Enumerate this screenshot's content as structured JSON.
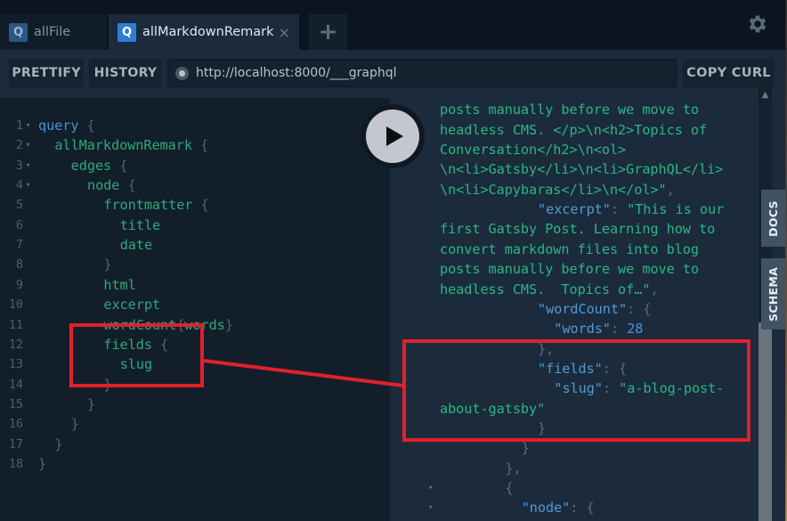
{
  "tabs": [
    {
      "badge": "Q",
      "label": "allFile",
      "active": false
    },
    {
      "badge": "Q",
      "label": "allMarkdownRemark",
      "active": true,
      "close": "×"
    }
  ],
  "new_tab_label": "+",
  "toolbar": {
    "prettify_label": "PRETTIFY",
    "history_label": "HISTORY",
    "url": "http://localhost:8000/___graphql",
    "copy_curl_label": "COPY CURL"
  },
  "side_tabs": {
    "docs": "DOCS",
    "schema": "SCHEMA"
  },
  "icons": {
    "settings": "gear-icon",
    "run": "play-icon",
    "scroll_up": "chevron-up-icon"
  },
  "colors": {
    "annotation": "#e0212b",
    "keyword": "#4a8fd6",
    "field": "#2fa87a",
    "string": "#2bb585",
    "key": "#4f9ad6"
  },
  "editor": {
    "lines": [
      {
        "n": "1",
        "fold": true,
        "indent": 0,
        "parts": [
          {
            "t": "query",
            "c": "kw"
          },
          {
            "t": " {",
            "c": "pn"
          }
        ]
      },
      {
        "n": "2",
        "fold": true,
        "indent": 2,
        "parts": [
          {
            "t": "allMarkdownRemark",
            "c": "fld"
          },
          {
            "t": " {",
            "c": "pn"
          }
        ]
      },
      {
        "n": "3",
        "fold": true,
        "indent": 4,
        "parts": [
          {
            "t": "edges",
            "c": "fld"
          },
          {
            "t": " {",
            "c": "pn"
          }
        ]
      },
      {
        "n": "4",
        "fold": true,
        "indent": 6,
        "parts": [
          {
            "t": "node",
            "c": "fld"
          },
          {
            "t": " {",
            "c": "pn"
          }
        ]
      },
      {
        "n": "5",
        "fold": false,
        "indent": 8,
        "parts": [
          {
            "t": "frontmatter",
            "c": "fld"
          },
          {
            "t": " {",
            "c": "pn"
          }
        ]
      },
      {
        "n": "6",
        "fold": false,
        "indent": 10,
        "parts": [
          {
            "t": "title",
            "c": "fld"
          }
        ]
      },
      {
        "n": "7",
        "fold": false,
        "indent": 10,
        "parts": [
          {
            "t": "date",
            "c": "fld"
          }
        ]
      },
      {
        "n": "8",
        "fold": false,
        "indent": 8,
        "parts": [
          {
            "t": "}",
            "c": "pn"
          }
        ]
      },
      {
        "n": "9",
        "fold": false,
        "indent": 8,
        "parts": [
          {
            "t": "html",
            "c": "fld"
          }
        ]
      },
      {
        "n": "10",
        "fold": false,
        "indent": 8,
        "parts": [
          {
            "t": "excerpt",
            "c": "fld"
          }
        ]
      },
      {
        "n": "11",
        "fold": false,
        "indent": 8,
        "parts": [
          {
            "t": "wordCount",
            "c": "fld"
          },
          {
            "t": "{",
            "c": "pn"
          },
          {
            "t": "words",
            "c": "fld"
          },
          {
            "t": "}",
            "c": "pn"
          }
        ]
      },
      {
        "n": "12",
        "fold": false,
        "indent": 8,
        "parts": [
          {
            "t": "fields",
            "c": "fld"
          },
          {
            "t": " {",
            "c": "pn"
          }
        ]
      },
      {
        "n": "13",
        "fold": false,
        "indent": 10,
        "parts": [
          {
            "t": "slug",
            "c": "fld"
          }
        ]
      },
      {
        "n": "14",
        "fold": false,
        "indent": 8,
        "parts": [
          {
            "t": "}",
            "c": "pn"
          }
        ]
      },
      {
        "n": "15",
        "fold": false,
        "indent": 6,
        "parts": [
          {
            "t": "}",
            "c": "pn"
          }
        ]
      },
      {
        "n": "16",
        "fold": false,
        "indent": 4,
        "parts": [
          {
            "t": "}",
            "c": "pn"
          }
        ]
      },
      {
        "n": "17",
        "fold": false,
        "indent": 2,
        "parts": [
          {
            "t": "}",
            "c": "pn"
          }
        ]
      },
      {
        "n": "18",
        "fold": false,
        "indent": 0,
        "parts": [
          {
            "t": "}",
            "c": "pn"
          }
        ]
      }
    ]
  },
  "result": {
    "lines": [
      {
        "indent": 0,
        "fold": false,
        "parts": [
          {
            "t": "convert markdown files into blog",
            "c": "rs"
          }
        ]
      },
      {
        "indent": 0,
        "fold": false,
        "parts": [
          {
            "t": "posts manually before we move to",
            "c": "rs"
          }
        ]
      },
      {
        "indent": 0,
        "fold": false,
        "parts": [
          {
            "t": "headless CMS. </p>\\n<h2>Topics of",
            "c": "rs"
          }
        ]
      },
      {
        "indent": 0,
        "fold": false,
        "parts": [
          {
            "t": "Conversation</h2>\\n<ol>",
            "c": "rs"
          }
        ]
      },
      {
        "indent": 0,
        "fold": false,
        "parts": [
          {
            "t": "\\n<li>Gatsby</li>\\n<li>GraphQL</li>",
            "c": "rs"
          }
        ]
      },
      {
        "indent": 0,
        "fold": false,
        "parts": [
          {
            "t": "\\n<li>Capybaras</li>\\n</ol>\"",
            "c": "rs"
          },
          {
            "t": ",",
            "c": "rp"
          }
        ]
      },
      {
        "indent": 12,
        "fold": false,
        "parts": [
          {
            "t": "\"excerpt\"",
            "c": "rk"
          },
          {
            "t": ": ",
            "c": "rp"
          },
          {
            "t": "\"This is our",
            "c": "rs"
          }
        ]
      },
      {
        "indent": 0,
        "fold": false,
        "parts": [
          {
            "t": "first Gatsby Post. Learning how to",
            "c": "rs"
          }
        ]
      },
      {
        "indent": 0,
        "fold": false,
        "parts": [
          {
            "t": "convert markdown files into blog",
            "c": "rs"
          }
        ]
      },
      {
        "indent": 0,
        "fold": false,
        "parts": [
          {
            "t": "posts manually before we move to",
            "c": "rs"
          }
        ]
      },
      {
        "indent": 0,
        "fold": false,
        "parts": [
          {
            "t": "headless CMS.  Topics of…\"",
            "c": "rs"
          },
          {
            "t": ",",
            "c": "rp"
          }
        ]
      },
      {
        "indent": 12,
        "fold": false,
        "parts": [
          {
            "t": "\"wordCount\"",
            "c": "rk"
          },
          {
            "t": ": {",
            "c": "rp"
          }
        ]
      },
      {
        "indent": 14,
        "fold": false,
        "parts": [
          {
            "t": "\"words\"",
            "c": "rk"
          },
          {
            "t": ": ",
            "c": "rp"
          },
          {
            "t": "28",
            "c": "rn"
          }
        ]
      },
      {
        "indent": 12,
        "fold": false,
        "parts": [
          {
            "t": "},",
            "c": "rp"
          }
        ]
      },
      {
        "indent": 12,
        "fold": false,
        "parts": [
          {
            "t": "\"fields\"",
            "c": "rk"
          },
          {
            "t": ": {",
            "c": "rp"
          }
        ]
      },
      {
        "indent": 14,
        "fold": false,
        "parts": [
          {
            "t": "\"slug\"",
            "c": "rk"
          },
          {
            "t": ": ",
            "c": "rp"
          },
          {
            "t": "\"a-blog-post-",
            "c": "rs"
          }
        ]
      },
      {
        "indent": 0,
        "fold": false,
        "parts": [
          {
            "t": "about-gatsby\"",
            "c": "rs"
          }
        ]
      },
      {
        "indent": 12,
        "fold": false,
        "parts": [
          {
            "t": "}",
            "c": "rp"
          }
        ]
      },
      {
        "indent": 10,
        "fold": false,
        "parts": [
          {
            "t": "}",
            "c": "rp"
          }
        ]
      },
      {
        "indent": 8,
        "fold": false,
        "parts": [
          {
            "t": "},",
            "c": "rp"
          }
        ]
      },
      {
        "indent": 8,
        "fold": true,
        "parts": [
          {
            "t": "{",
            "c": "rp"
          }
        ]
      },
      {
        "indent": 10,
        "fold": true,
        "parts": [
          {
            "t": "\"node\"",
            "c": "rk"
          },
          {
            "t": ": {",
            "c": "rp"
          }
        ]
      }
    ]
  }
}
